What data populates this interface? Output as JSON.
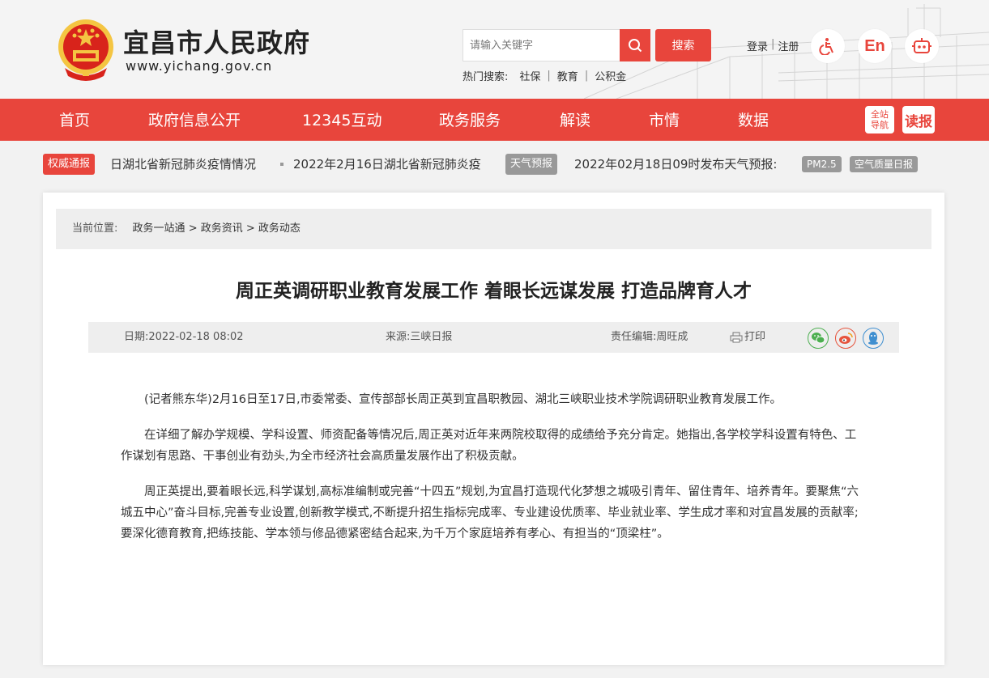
{
  "header": {
    "site_title": "宜昌市人民政府",
    "site_url": "www.yichang.gov.cn",
    "search_placeholder": "请输入关键字",
    "search_button": "搜索",
    "hot_label": "热门搜索:",
    "hot_items": [
      "社保",
      "教育",
      "公积金"
    ],
    "login": "登录",
    "register": "注册",
    "english": "En"
  },
  "nav": {
    "items": [
      "首页",
      "政府信息公开",
      "12345互动",
      "政务服务",
      "解读",
      "市情",
      "数据"
    ],
    "all_nav_line1": "全站",
    "all_nav_line2": "导航",
    "read_label": "读报"
  },
  "notice": {
    "auth_tag": "权威通报",
    "items": [
      "日湖北省新冠肺炎疫情情况",
      "2022年2月16日湖北省新冠肺炎疫"
    ],
    "weather_tag": "天气预报",
    "weather_text": "2022年02月18日09时发布天气预报:",
    "pm_badge": "PM2.5",
    "air_badge": "空气质量日报"
  },
  "breadcrumb": {
    "label": "当前位置:",
    "items": [
      "政务一站通",
      "政务资讯",
      "政务动态"
    ]
  },
  "article": {
    "title": "周正英调研职业教育发展工作 着眼长远谋发展 打造品牌育人才",
    "date": "日期:2022-02-18 08:02",
    "source": "来源:三峡日报",
    "editor": "责任编辑:周旺成",
    "print": "打印",
    "paragraphs": [
      "(记者熊东华)2月16日至17日,市委常委、宣传部部长周正英到宜昌职教园、湖北三峡职业技术学院调研职业教育发展工作。",
      "在详细了解办学规模、学科设置、师资配备等情况后,周正英对近年来两院校取得的成绩给予充分肯定。她指出,各学校学科设置有特色、工作谋划有思路、干事创业有劲头,为全市经济社会高质量发展作出了积极贡献。",
      "周正英提出,要着眼长远,科学谋划,高标准编制或完善“十四五”规划,为宜昌打造现代化梦想之城吸引青年、留住青年、培养青年。要聚焦“六城五中心”奋斗目标,完善专业设置,创新教学模式,不断提升招生指标完成率、专业建设优质率、毕业就业率、学生成才率和对宜昌发展的贡献率;要深化德育教育,把练技能、学本领与修品德紧密结合起来,为千万个家庭培养有孝心、有担当的“顶梁柱”。"
    ]
  },
  "colors": {
    "brand_red": "#e8453c",
    "gray_tag": "#999999",
    "wechat_green": "#4caf50",
    "weibo_red": "#e6533c",
    "qq_blue": "#3f8fd0"
  }
}
